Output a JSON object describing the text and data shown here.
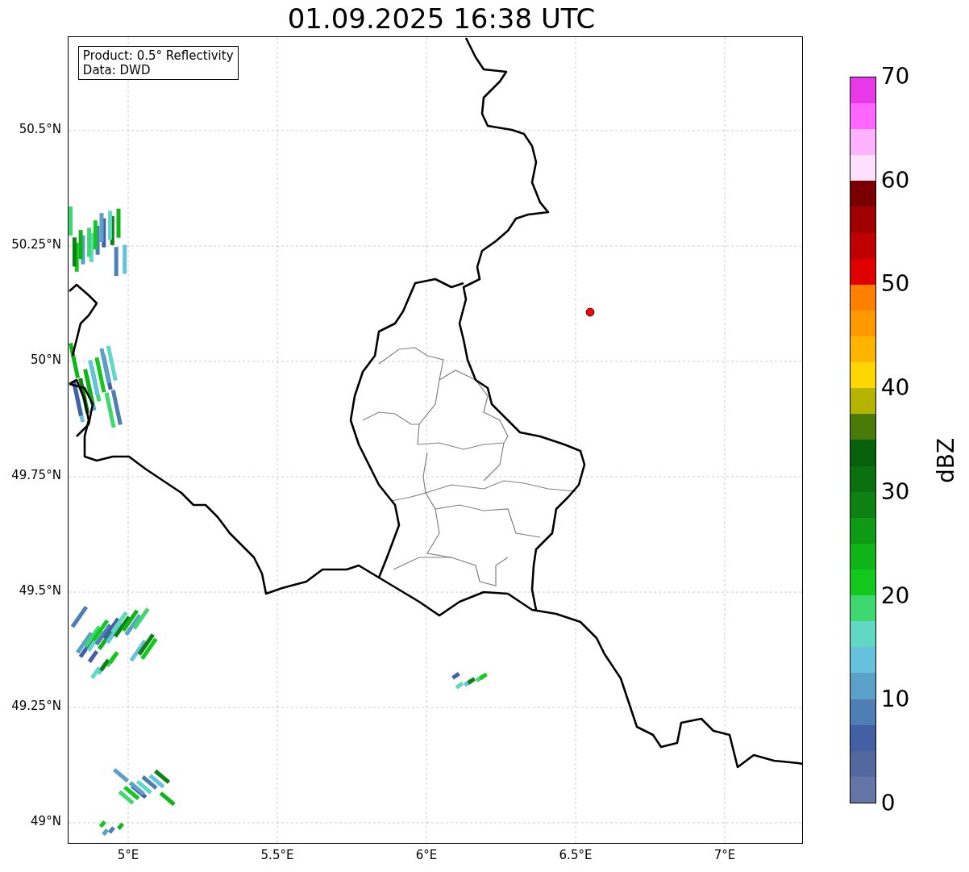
{
  "title": "01.09.2025 16:38 UTC",
  "legend": [
    "Product: 0.5° Reflectivity",
    "Data: DWD"
  ],
  "axes": {
    "y_ticks": [
      "50.5°N",
      "50.25°N",
      "50°N",
      "49.75°N",
      "49.5°N",
      "49.25°N",
      "49°N"
    ],
    "x_ticks": [
      "5°E",
      "5.5°E",
      "6°E",
      "6.5°E",
      "7°E"
    ]
  },
  "colorbar": {
    "label": "dBZ",
    "ticks": [
      "70",
      "60",
      "50",
      "40",
      "30",
      "20",
      "10",
      "0"
    ],
    "segments": [
      {
        "color": "#6476a8"
      },
      {
        "color": "#5468a0"
      },
      {
        "color": "#4460a4"
      },
      {
        "color": "#4e7eb4"
      },
      {
        "color": "#5aa0c8"
      },
      {
        "color": "#66c2dc"
      },
      {
        "color": "#62d8c4"
      },
      {
        "color": "#3ed870"
      },
      {
        "color": "#12c81c"
      },
      {
        "color": "#0fb418"
      },
      {
        "color": "#0e9a14"
      },
      {
        "color": "#0d8212"
      },
      {
        "color": "#0b700f"
      },
      {
        "color": "#06600c"
      },
      {
        "color": "#4a7a0a"
      },
      {
        "color": "#b4b400"
      },
      {
        "color": "#ffd700"
      },
      {
        "color": "#ffb400"
      },
      {
        "color": "#ff9900"
      },
      {
        "color": "#ff7f00"
      },
      {
        "color": "#e00000"
      },
      {
        "color": "#c00000"
      },
      {
        "color": "#a00000"
      },
      {
        "color": "#7a0000"
      },
      {
        "color": "#ffe0ff"
      },
      {
        "color": "#ffb3ff"
      },
      {
        "color": "#ff66ff"
      },
      {
        "color": "#e838e8"
      }
    ]
  }
}
